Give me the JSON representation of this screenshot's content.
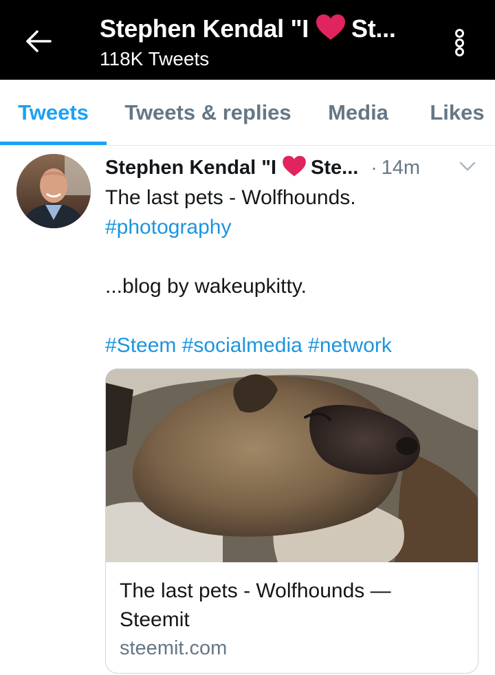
{
  "header": {
    "title_prefix": "Stephen Kendal \"I",
    "title_suffix": "St...",
    "tweet_count": "118K Tweets"
  },
  "tabs": [
    {
      "label": "Tweets",
      "active": true
    },
    {
      "label": "Tweets & replies",
      "active": false
    },
    {
      "label": "Media",
      "active": false
    },
    {
      "label": "Likes",
      "active": false
    }
  ],
  "tweet": {
    "author_prefix": "Stephen Kendal \"I",
    "author_suffix": "Ste...",
    "separator": "·",
    "time": "14m",
    "text_line1": "The last pets - Wolfhounds.",
    "hashtag1": "#photography",
    "text_line2": "...blog by wakeupkitty.",
    "hashtags": [
      "#Steem",
      "#socialmedia",
      "#network"
    ]
  },
  "card": {
    "title": "The last pets - Wolfhounds — Steemit",
    "domain": "steemit.com"
  },
  "colors": {
    "accent": "#1da1f2",
    "heart": "#e0245e",
    "secondary_text": "#657786",
    "header_bg": "#000000"
  },
  "icons": {
    "back": "arrow-left-icon",
    "more": "more-vertical-icon",
    "heart": "heart-icon",
    "caret": "chevron-down-icon"
  }
}
